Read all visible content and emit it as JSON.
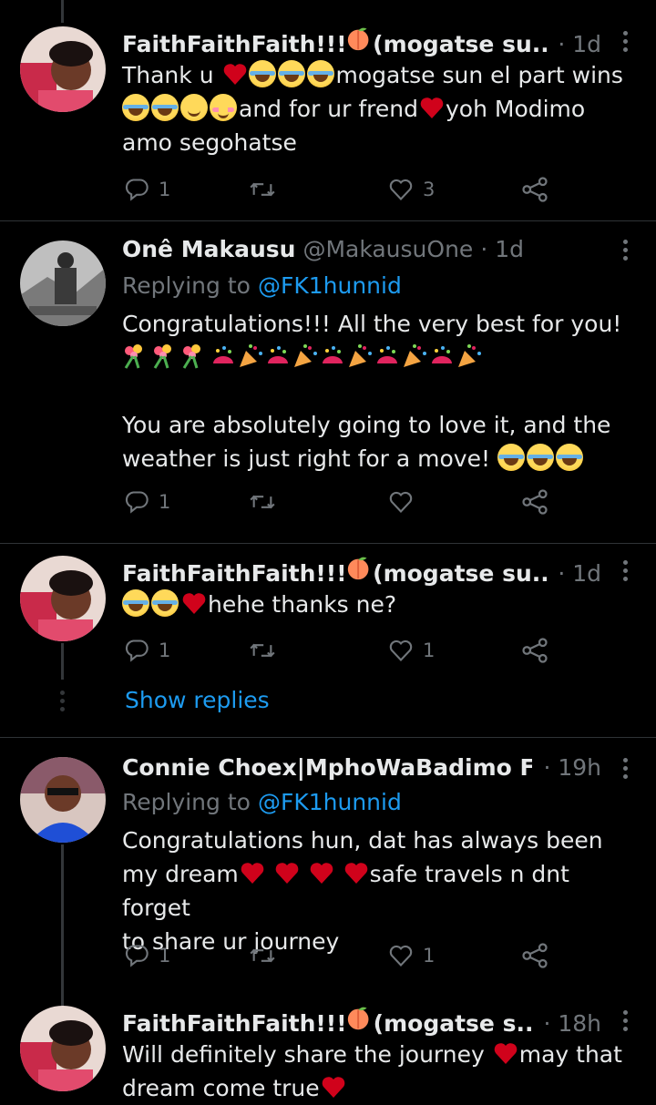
{
  "tweets": [
    {
      "name": "FaithFaithFaith!!!!",
      "name_suffix": "(mogatse su...",
      "time": "· 1d",
      "lines": [
        "Thank u",
        "mogatse sun el part wins",
        "and for ur frend",
        "yoh Modimo",
        "amo segohatse"
      ],
      "replies": "1",
      "likes": "3"
    },
    {
      "name": "Onê Makausu",
      "handle": "@MakausuOne",
      "time": "· 1d",
      "replying_label": "Replying to",
      "replying_to": "@FK1hunnid",
      "lines": [
        "Congratulations!!! All the very best for you!",
        "You are absolutely going to love it, and the",
        "weather is just right for a move!"
      ],
      "replies": "1",
      "likes": ""
    },
    {
      "name": "FaithFaithFaith!!!!",
      "name_suffix": "(mogatse su...",
      "time": "· 1d",
      "lines": [
        "hehe thanks ne?"
      ],
      "replies": "1",
      "likes": "1"
    },
    {
      "name": "Connie Choex|MphoWaBadimo F...",
      "time": "· 19h",
      "replying_label": "Replying to",
      "replying_to": "@FK1hunnid",
      "lines": [
        "Congratulations hun, dat has always been",
        "my dream",
        "safe travels n dnt forget",
        "to share ur journey"
      ],
      "replies": "1",
      "likes": "1"
    },
    {
      "name": "FaithFaithFaith!!!!",
      "name_suffix": "(mogatse s...",
      "time": "· 18h",
      "lines": [
        "Will definitely share the journey",
        "may that",
        "dream come true"
      ]
    }
  ],
  "show_replies": "Show replies",
  "icons": {
    "reply": "reply-icon",
    "retweet": "retweet-icon",
    "like": "heart-outline-icon",
    "share": "share-icon",
    "more": "more-vertical-icon"
  },
  "colors": {
    "background": "#000000",
    "text": "#e7e9ea",
    "muted": "#71767b",
    "link": "#1d9bf0",
    "heart": "#d0021b"
  }
}
